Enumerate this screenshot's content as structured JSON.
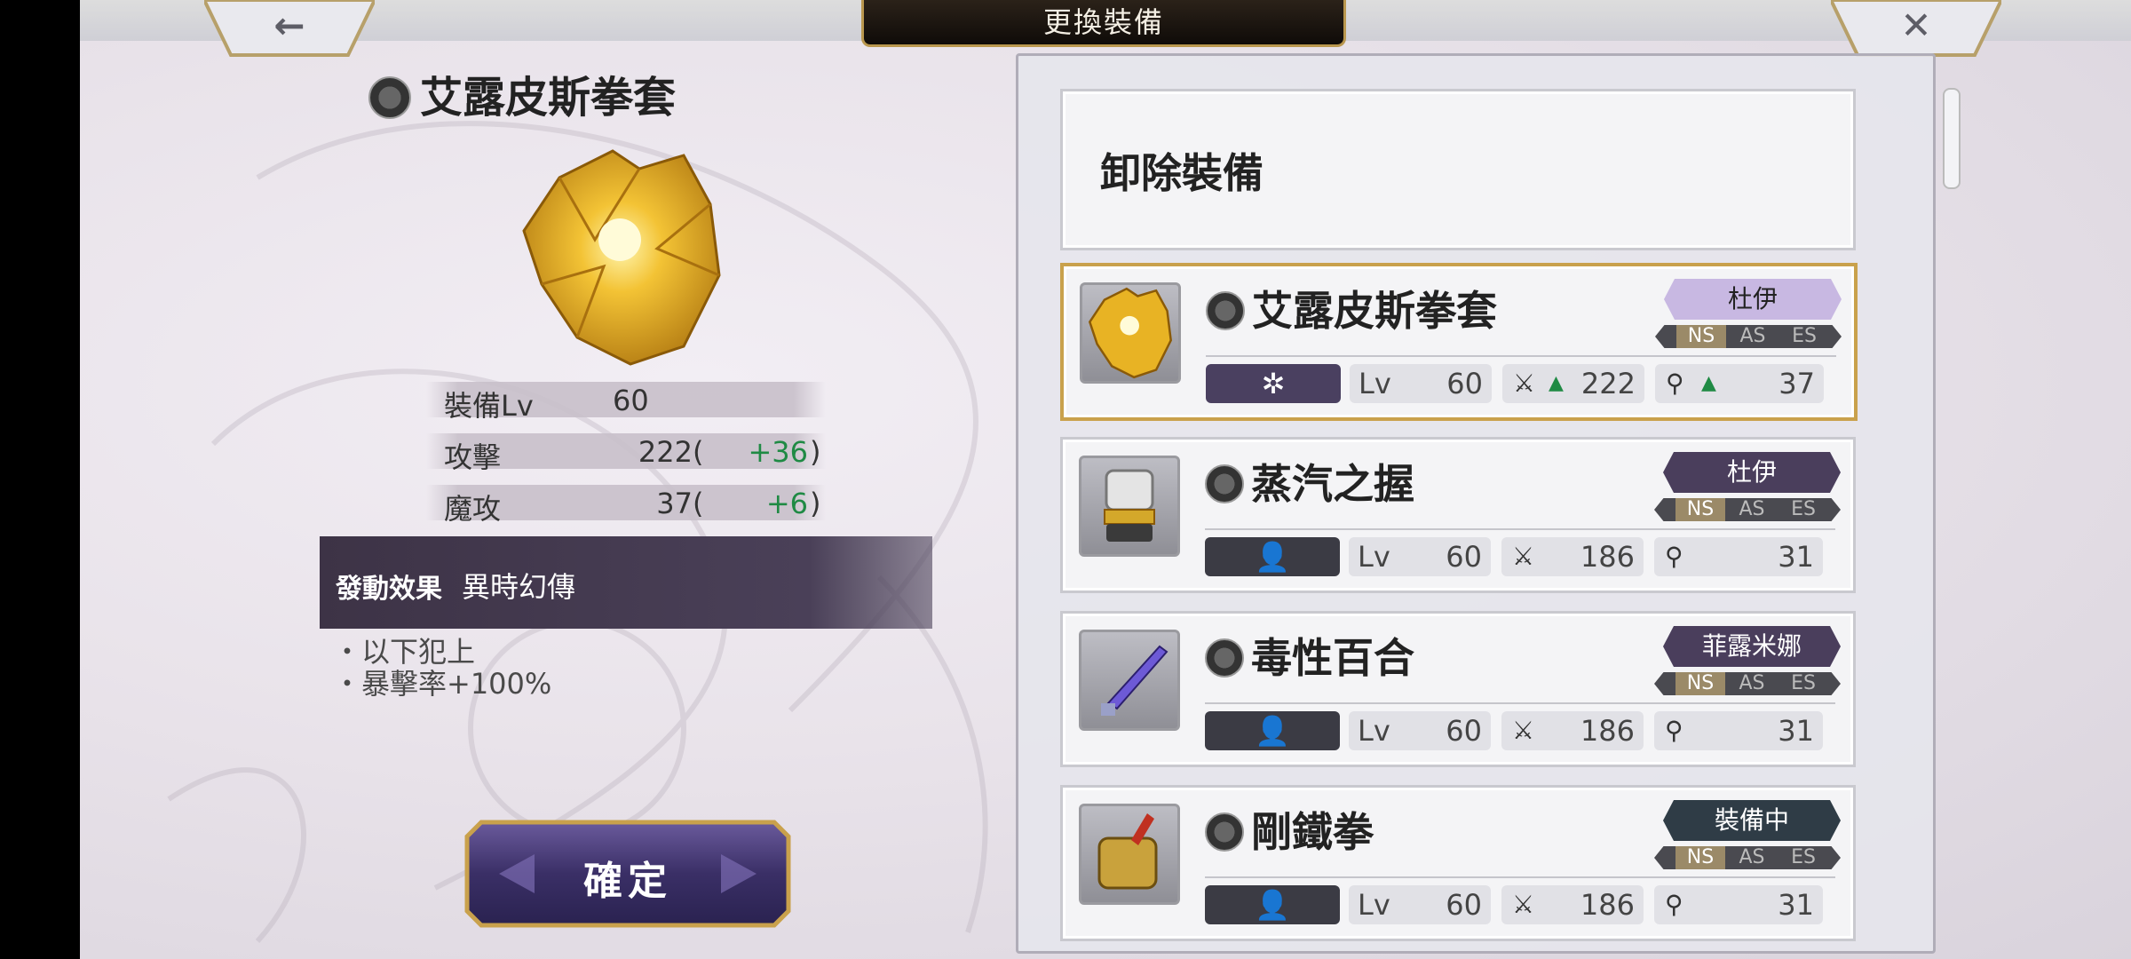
{
  "header": {
    "title": "更換裝備",
    "back_glyph": "←",
    "close_glyph": "✕"
  },
  "detail": {
    "name": "艾露皮斯拳套",
    "stats": [
      {
        "label": "裝備Lv",
        "value": "60",
        "bonus": ""
      },
      {
        "label": "攻擊",
        "value": "222",
        "bonus": "+36"
      },
      {
        "label": "魔攻",
        "value": "37",
        "bonus": "+6"
      }
    ],
    "effect_label": "發動效果",
    "effect_name": "異時幻傳",
    "effect_lines": [
      "・以下犯上",
      "・暴擊率+100%"
    ],
    "confirm_label": "確定"
  },
  "list": {
    "unequip_label": "卸除裝備",
    "items": [
      {
        "name": "艾露皮斯拳套",
        "owner": "杜伊",
        "lv_label": "Lv",
        "lv": "60",
        "atk": "222",
        "mag": "37",
        "type_icon": "sparkle-icon",
        "selected": true
      },
      {
        "name": "蒸汽之握",
        "owner": "杜伊",
        "lv_label": "Lv",
        "lv": "60",
        "atk": "186",
        "mag": "31",
        "type_icon": "person-icon",
        "selected": false
      },
      {
        "name": "毒性百合",
        "owner": "菲露米娜",
        "lv_label": "Lv",
        "lv": "60",
        "atk": "186",
        "mag": "31",
        "type_icon": "person-icon",
        "selected": false
      },
      {
        "name": "剛鐵拳",
        "owner": "裝備中",
        "lv_label": "Lv",
        "lv": "60",
        "atk": "186",
        "mag": "31",
        "type_icon": "person-icon",
        "selected": false
      }
    ],
    "tags": {
      "ns": "NS",
      "as": "AS",
      "es": "ES"
    }
  }
}
